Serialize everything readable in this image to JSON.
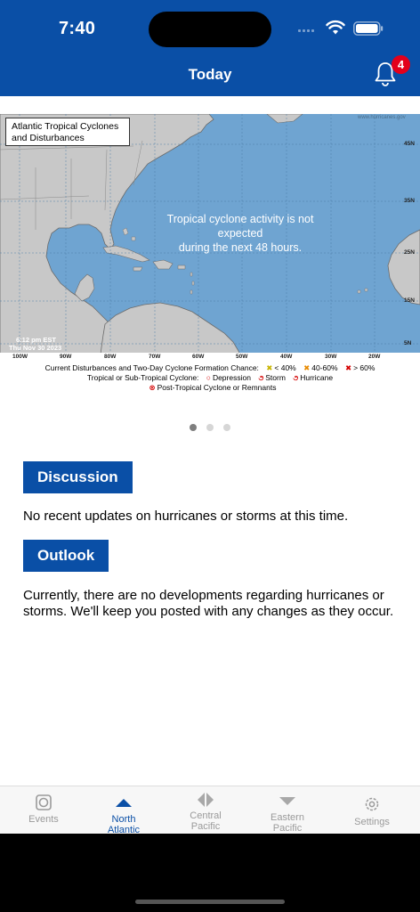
{
  "status_bar": {
    "time": "7:40"
  },
  "header": {
    "title": "Today",
    "notification_count": "4"
  },
  "map": {
    "title_line1": "Atlantic Tropical Cyclones",
    "title_line2": "and Disturbances",
    "message_line1": "Tropical cyclone activity is not expected",
    "message_line2": "during the next 48 hours.",
    "timestamp_line1": "6:12 pm EST",
    "timestamp_line2": "Thu Nov 30 2023",
    "credit": "www.hurricanes.gov",
    "lat_labels": [
      "45N",
      "35N",
      "25N",
      "15N",
      "5N"
    ],
    "lon_labels": [
      "100W",
      "90W",
      "80W",
      "70W",
      "60W",
      "50W",
      "40W",
      "30W",
      "20W"
    ],
    "legend_line1_label": "Current Disturbances and Two-Day Cyclone Formation Chance:",
    "legend_low": "< 40%",
    "legend_mid": "40-60%",
    "legend_high": "> 60%",
    "legend_line2_label": "Tropical or Sub-Tropical Cyclone:",
    "legend_depression": "Depression",
    "legend_storm": "Storm",
    "legend_hurricane": "Hurricane",
    "legend_post": "Post-Tropical Cyclone or Remnants",
    "colors": {
      "ocean": "#6fa4d1",
      "land": "#c8c8c8",
      "low": "#e8e800",
      "mid": "#e88a00",
      "high": "#d40000"
    }
  },
  "carousel": {
    "count": 3,
    "active": 0
  },
  "discussion": {
    "heading": "Discussion",
    "text": "No recent updates on hurricanes or storms at this time."
  },
  "outlook": {
    "heading": "Outlook",
    "text": "Currently, there are no developments regarding hurricanes or storms. We'll keep you posted with any changes as they occur."
  },
  "tabs": {
    "events": {
      "label": "Events",
      "icon": "events-icon"
    },
    "north_atlantic": {
      "label_line1": "North",
      "label_line2": "Atlantic",
      "icon": "triangle-up-icon"
    },
    "central_pacific": {
      "label_line1": "Central",
      "label_line2": "Pacific",
      "icon": "diamond-icon"
    },
    "eastern_pacific": {
      "label_line1": "Eastern",
      "label_line2": "Pacific",
      "icon": "triangle-down-icon"
    },
    "settings": {
      "label": "Settings",
      "icon": "gear-icon"
    }
  }
}
